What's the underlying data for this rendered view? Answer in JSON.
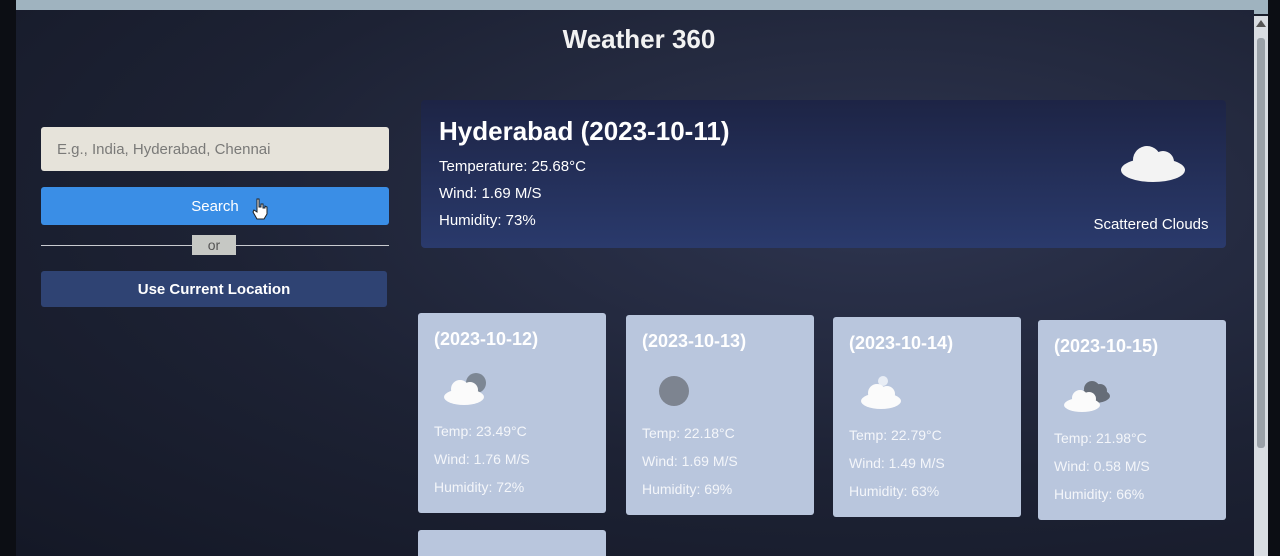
{
  "app": {
    "title": "Weather 360"
  },
  "search": {
    "placeholder": "E.g., India, Hyderabad, Chennai",
    "button_label": "Search",
    "divider_label": "or",
    "location_button_label": "Use Current Location"
  },
  "current": {
    "title": "Hyderabad (2023-10-11)",
    "temperature": "Temperature: 25.68°C",
    "wind": "Wind: 1.69 M/S",
    "humidity": "Humidity: 73%",
    "icon": "scattered-clouds-icon",
    "description": "Scattered Clouds"
  },
  "forecast": [
    {
      "date": "(2023-10-12)",
      "icon": "partly-cloudy-icon",
      "temp": "Temp: 23.49°C",
      "wind": "Wind: 1.76 M/S",
      "humidity": "Humidity: 72%"
    },
    {
      "date": "(2023-10-13)",
      "icon": "overcast-icon",
      "temp": "Temp: 22.18°C",
      "wind": "Wind: 1.69 M/S",
      "humidity": "Humidity: 69%"
    },
    {
      "date": "(2023-10-14)",
      "icon": "few-clouds-icon",
      "temp": "Temp: 22.79°C",
      "wind": "Wind: 1.49 M/S",
      "humidity": "Humidity: 63%"
    },
    {
      "date": "(2023-10-15)",
      "icon": "broken-clouds-icon",
      "temp": "Temp: 21.98°C",
      "wind": "Wind: 0.58 M/S",
      "humidity": "Humidity: 66%"
    }
  ],
  "colors": {
    "accent": "#3a8ee6",
    "location_button": "#2f4373",
    "card": "#b9c6dd",
    "current_card": "#2a3a6c"
  }
}
